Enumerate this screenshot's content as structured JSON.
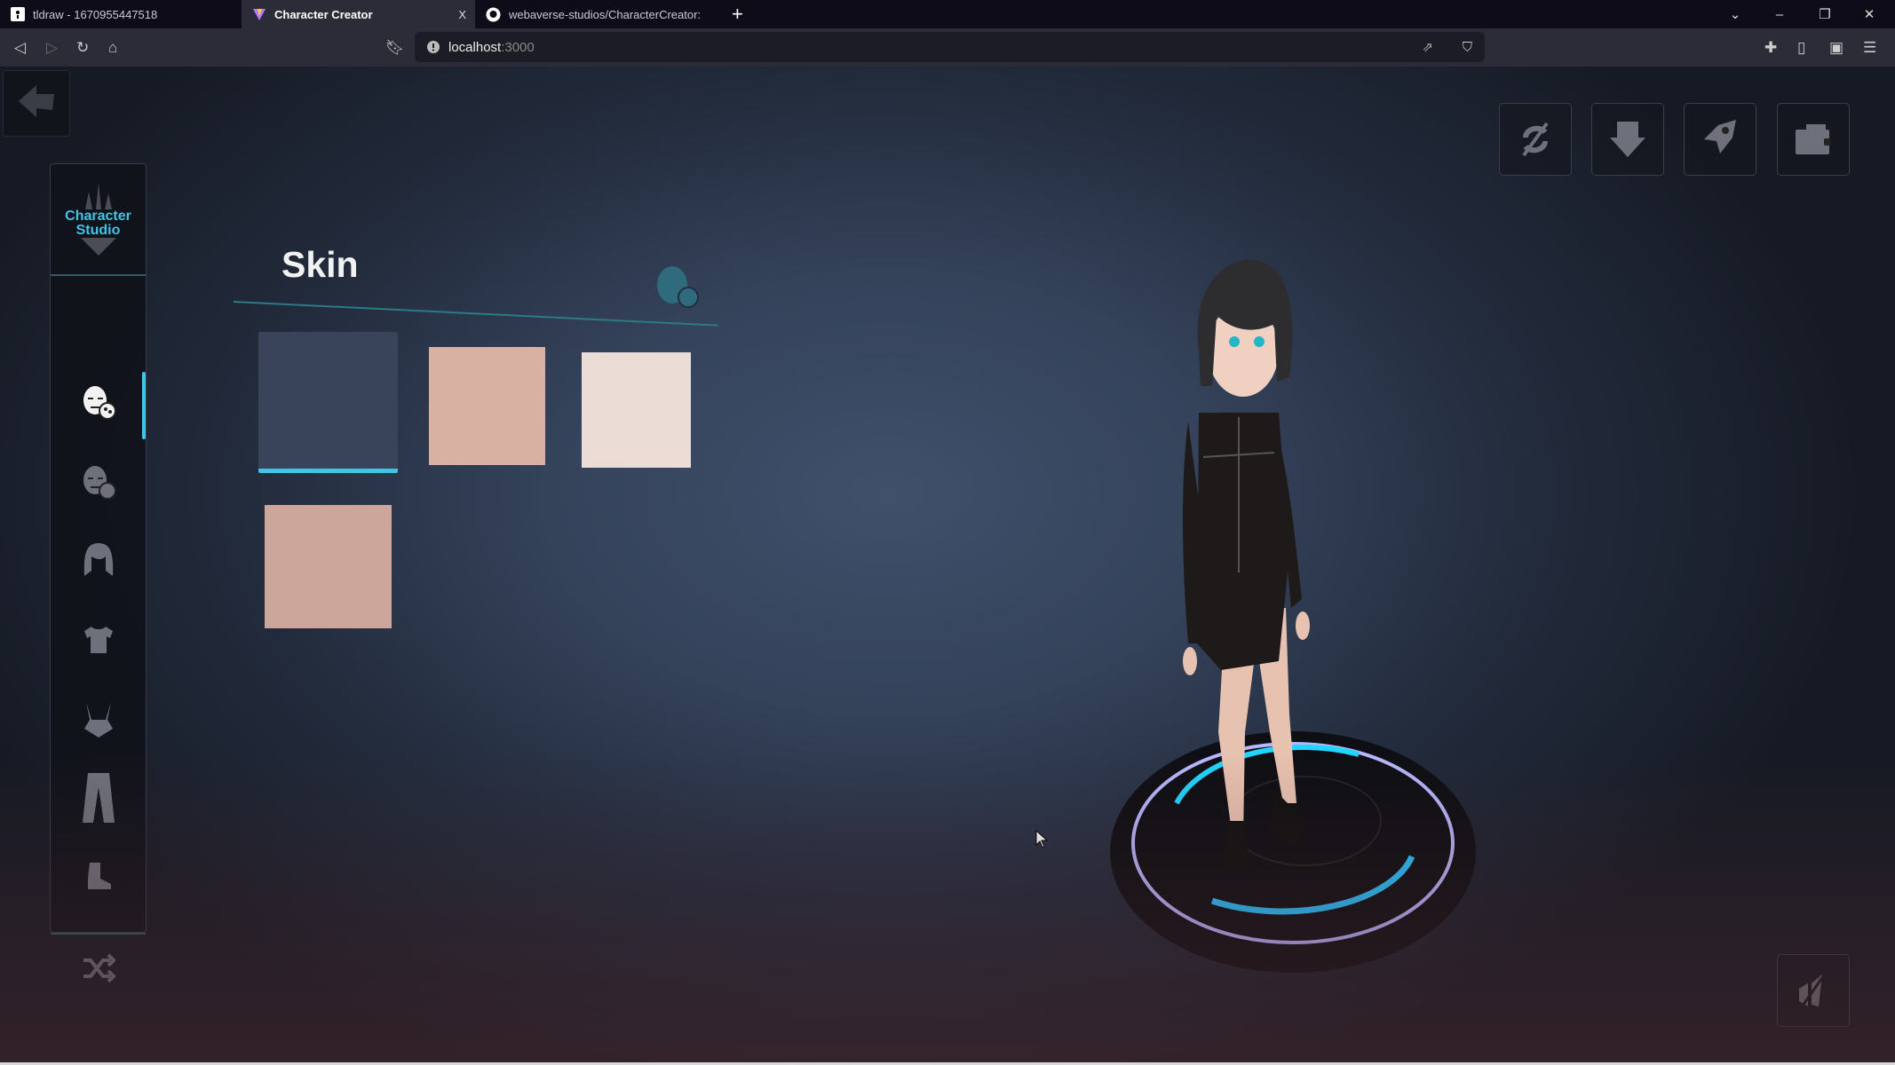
{
  "browser": {
    "tabs": [
      {
        "title": "tldraw - 1670955447518",
        "icon": "tldraw-icon"
      },
      {
        "title": "Character Creator",
        "icon": "vite-icon",
        "active": true,
        "close": "X"
      },
      {
        "title": "webaverse-studios/CharacterCreator:",
        "icon": "github-icon"
      }
    ],
    "new_tab": "+",
    "url_host": "localhost",
    "url_port": ":3000"
  },
  "app": {
    "logo_line1": "Character",
    "logo_line2": "Studio",
    "section_title": "Skin",
    "sidebar_items": [
      {
        "name": "skin",
        "icon": "face-palette-icon",
        "active": true
      },
      {
        "name": "face",
        "icon": "face-palette-icon"
      },
      {
        "name": "hair",
        "icon": "hair-icon"
      },
      {
        "name": "shirt",
        "icon": "shirt-icon"
      },
      {
        "name": "chest",
        "icon": "torso-icon"
      },
      {
        "name": "legs",
        "icon": "pants-icon"
      },
      {
        "name": "shoes",
        "icon": "boot-icon"
      }
    ],
    "shuffle_icon": "shuffle-icon",
    "skin_tiles": [
      {
        "color": "#39435a",
        "selected": true
      },
      {
        "color": "#d8b1a3"
      },
      {
        "color": "#ecdcd6"
      },
      {
        "color": "#cca69a"
      }
    ],
    "top_buttons": [
      "sync-icon",
      "download-icon",
      "rocket-icon",
      "wallet-icon"
    ],
    "bottom_button": "sound-mute-icon",
    "accent": "#3ec5e8"
  }
}
